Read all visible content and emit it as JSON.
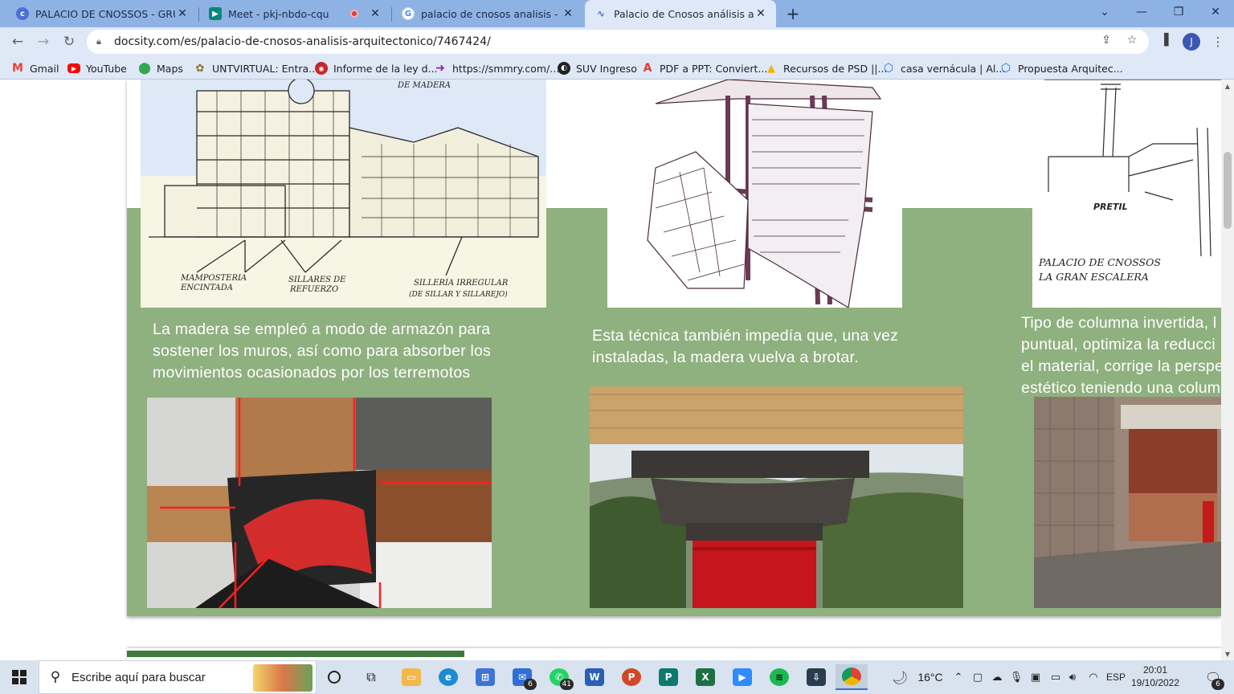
{
  "browser": {
    "tabs": [
      {
        "title": "PALACIO DE CNOSSOS - GRUPO",
        "favicon": "docsity-icon",
        "active": false
      },
      {
        "title": "Meet - pkj-nbdo-cqu",
        "favicon": "meet-icon",
        "active": false,
        "recording": true
      },
      {
        "title": "palacio de cnosos analisis - Busca",
        "favicon": "google-icon",
        "active": false
      },
      {
        "title": "Palacio de Cnosos análisis arquite",
        "favicon": "docsity-wave-icon",
        "active": true
      }
    ],
    "new_tab_symbol": "+",
    "window_controls": {
      "dropdown": "⌄",
      "minimize": "—",
      "restore": "❐",
      "close": "✕"
    },
    "url": "docsity.com/es/palacio-de-cnosos-analisis-arquitectonico/7467424/",
    "profile_initial": "J",
    "bookmarks": [
      {
        "label": "Gmail",
        "icon": "gmail-icon"
      },
      {
        "label": "YouTube",
        "icon": "youtube-icon"
      },
      {
        "label": "Maps",
        "icon": "maps-icon"
      },
      {
        "label": "UNTVIRTUAL: Entra...",
        "icon": "untvirtual-icon"
      },
      {
        "label": "Informe de la ley d...",
        "icon": "informe-icon"
      },
      {
        "label": "https://smmry.com/...",
        "icon": "smmry-icon"
      },
      {
        "label": "SUV Ingreso",
        "icon": "globe-icon"
      },
      {
        "label": "PDF a PPT: Conviert...",
        "icon": "adobe-icon"
      },
      {
        "label": "Recursos de PSD ||...",
        "icon": "drive-icon"
      },
      {
        "label": "casa vernácula | Al...",
        "icon": "hex-icon"
      },
      {
        "label": "Propuesta Arquitec...",
        "icon": "hex-icon"
      }
    ]
  },
  "slide": {
    "drawing_labels": {
      "d1_top": "DE MADERA",
      "d1_a": "MAMPOSTERIA",
      "d1_a2": "ENCINTADA",
      "d1_b": "SILLARES DE",
      "d1_b2": "REFUERZO",
      "d1_c": "SILLERIA IRREGULAR",
      "d1_c2": "(DE SILLAR Y SILLAREJO)",
      "d3_pretil": "PRETIL",
      "d3_title": "PALACIO DE CNOSSOS",
      "d3_title2": "LA GRAN ESCALERA"
    },
    "captions": [
      {
        "lines": [
          "La madera se empleó a modo de armazón para",
          "sostener los muros, así como para absorber los",
          "movimientos ocasionados por los terremotos"
        ]
      },
      {
        "lines": [
          "Esta técnica también impedía que, una vez",
          "instaladas, la madera vuelva a brotar."
        ]
      },
      {
        "lines": [
          "Tipo de columna invertida, l",
          "puntual, optimiza la reducci",
          "el material, corrige la perspe",
          "estético teniendo una colum"
        ]
      }
    ]
  },
  "taskbar": {
    "search_placeholder": "Escribe aquí para buscar",
    "apps": [
      {
        "name": "cortana-icon"
      },
      {
        "name": "task-view-icon"
      },
      {
        "name": "file-explorer-icon"
      },
      {
        "name": "edge-icon"
      },
      {
        "name": "store-icon"
      },
      {
        "name": "mail-icon",
        "badge": "6"
      },
      {
        "name": "whatsapp-icon",
        "badge": "41"
      },
      {
        "name": "word-icon"
      },
      {
        "name": "powerpoint-icon"
      },
      {
        "name": "publisher-icon"
      },
      {
        "name": "excel-icon"
      },
      {
        "name": "zoom-icon"
      },
      {
        "name": "spotify-icon"
      },
      {
        "name": "installer-icon"
      },
      {
        "name": "chrome-icon"
      }
    ],
    "weather": "16°C",
    "language": "ESP",
    "time": "20:01",
    "date": "19/10/2022",
    "notifications": "6"
  }
}
